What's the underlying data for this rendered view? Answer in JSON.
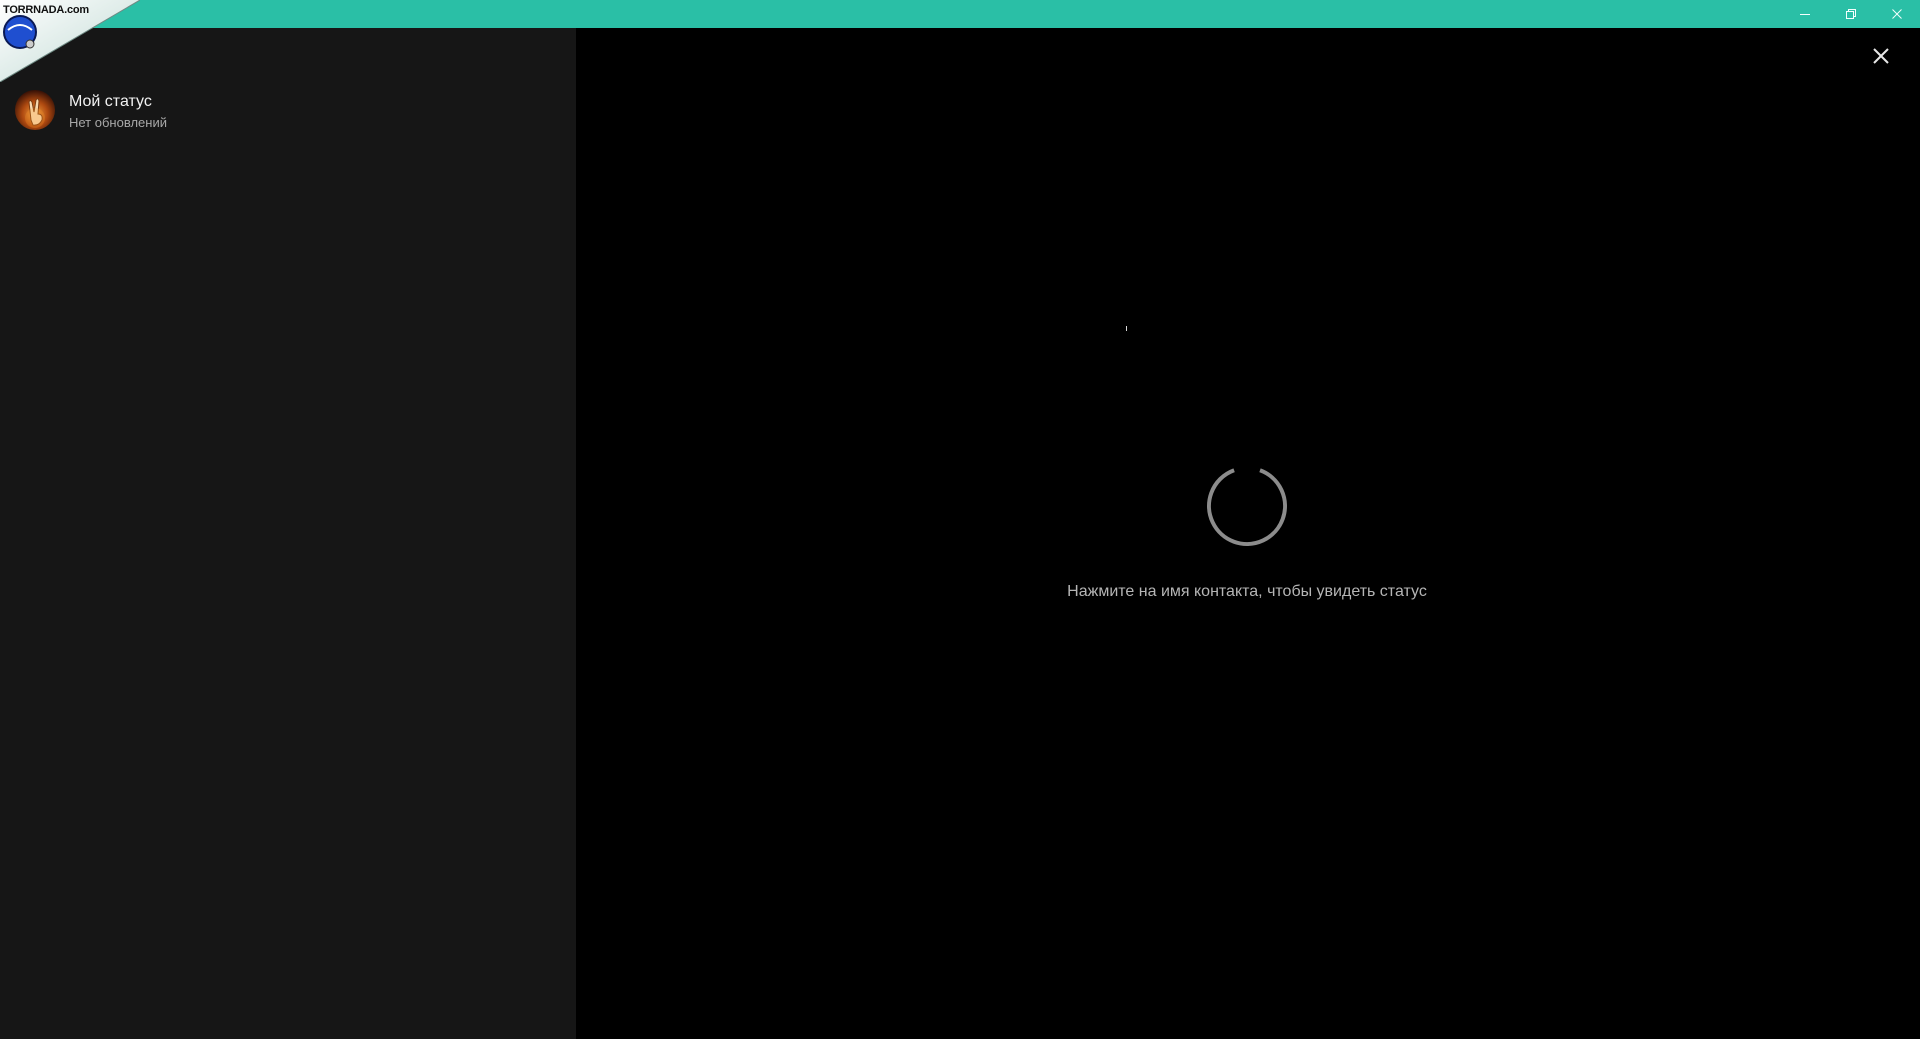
{
  "titlebar": {
    "color": "#2abfa6",
    "controls": {
      "minimize_icon": "minimize-icon",
      "restore_icon": "restore-icon",
      "close_icon": "close-icon"
    }
  },
  "watermark": {
    "text": "TORRNADA.com"
  },
  "sidebar": {
    "my_status": {
      "title": "Мой статус",
      "subtitle": "Нет обновлений"
    }
  },
  "main": {
    "close_icon": "close-icon",
    "spinner_icon": "loading-spinner-icon",
    "hint": "Нажмите на имя контакта, чтобы увидеть статус"
  }
}
